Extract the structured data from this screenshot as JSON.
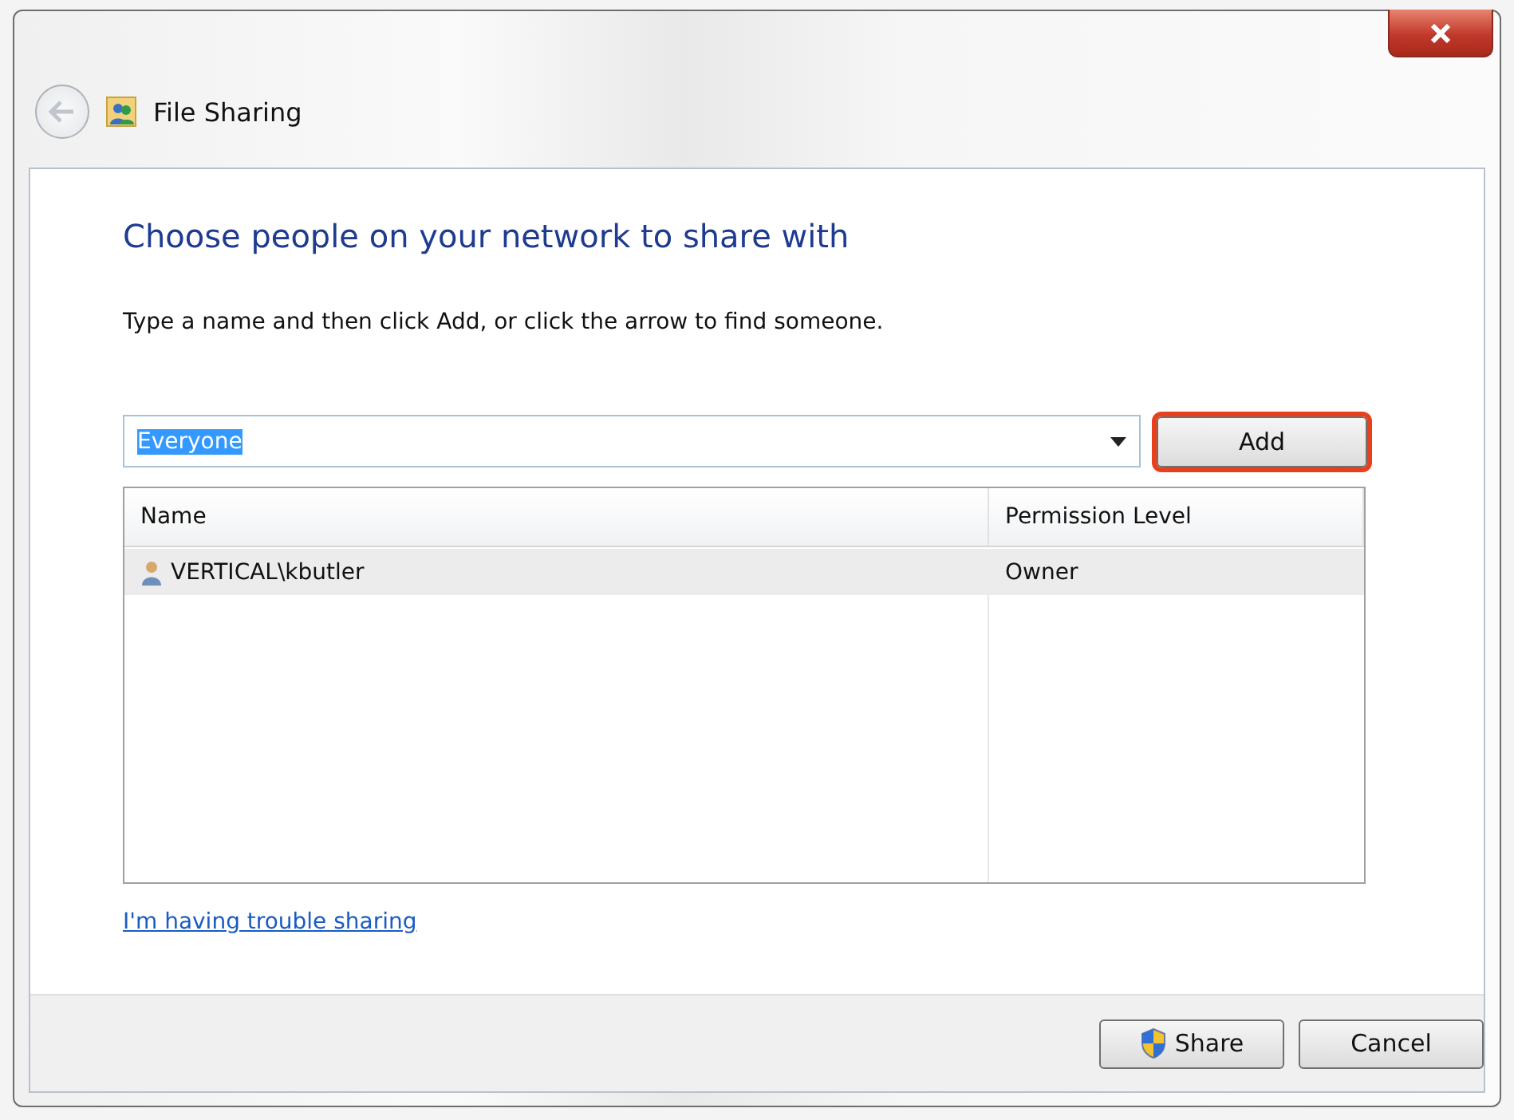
{
  "window": {
    "title": "File Sharing",
    "back_disabled": true
  },
  "heading": "Choose people on your network to share with",
  "instruction": "Type a name and then click Add, or click the arrow to find someone.",
  "name_field": {
    "value": "Everyone",
    "text_selected": true
  },
  "add_button": {
    "label": "Add",
    "highlighted": true
  },
  "table": {
    "columns": [
      "Name",
      "Permission Level"
    ],
    "rows": [
      {
        "name": "VERTICAL\\kbutler",
        "permission": "Owner",
        "selected": true
      }
    ]
  },
  "help_link": "I'm having trouble sharing",
  "buttons": [
    {
      "kind": "shield",
      "label": "Share"
    },
    {
      "kind": "plain",
      "label": "Cancel"
    }
  ]
}
